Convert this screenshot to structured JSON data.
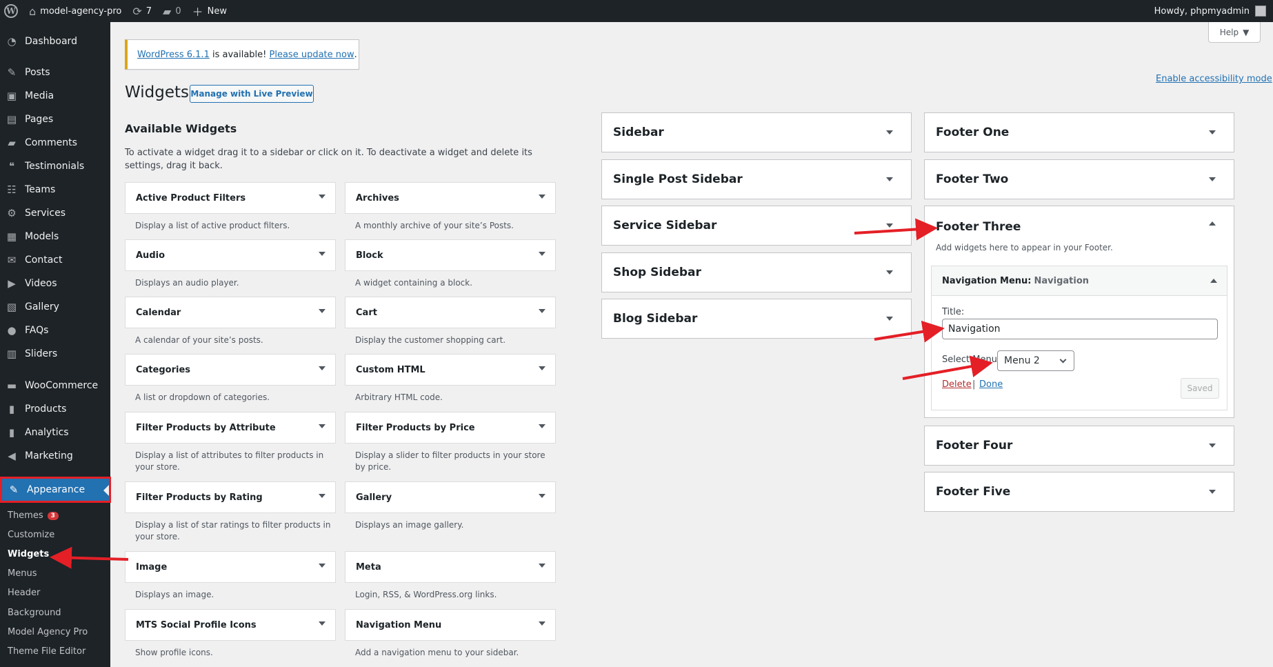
{
  "admin_bar": {
    "site_name": "model-agency-pro",
    "updates_count": "7",
    "comments_count": "0",
    "new_label": "New",
    "greeting": "Howdy, phpmyadmin"
  },
  "sidebar": {
    "items": [
      {
        "label": "Dashboard",
        "icon": "dashboard-icon"
      },
      {
        "label": "Posts",
        "icon": "pin-icon"
      },
      {
        "label": "Media",
        "icon": "media-icon"
      },
      {
        "label": "Pages",
        "icon": "pages-icon"
      },
      {
        "label": "Comments",
        "icon": "comment-icon"
      },
      {
        "label": "Testimonials",
        "icon": "testimonial-icon"
      },
      {
        "label": "Teams",
        "icon": "groups-icon"
      },
      {
        "label": "Services",
        "icon": "services-icon"
      },
      {
        "label": "Models",
        "icon": "models-icon"
      },
      {
        "label": "Contact",
        "icon": "mail-icon"
      },
      {
        "label": "Videos",
        "icon": "video-icon"
      },
      {
        "label": "Gallery",
        "icon": "gallery-icon"
      },
      {
        "label": "FAQs",
        "icon": "faq-icon"
      },
      {
        "label": "Sliders",
        "icon": "sliders-icon"
      },
      {
        "label": "WooCommerce",
        "icon": "woo-icon"
      },
      {
        "label": "Products",
        "icon": "products-icon"
      },
      {
        "label": "Analytics",
        "icon": "analytics-icon"
      },
      {
        "label": "Marketing",
        "icon": "megaphone-icon"
      },
      {
        "label": "Appearance",
        "icon": "paintbrush-icon"
      }
    ],
    "submenu": [
      {
        "label": "Themes",
        "badge": "3"
      },
      {
        "label": "Customize"
      },
      {
        "label": "Widgets"
      },
      {
        "label": "Menus"
      },
      {
        "label": "Header"
      },
      {
        "label": "Background"
      },
      {
        "label": "Model Agency Pro"
      },
      {
        "label": "Theme File Editor"
      }
    ]
  },
  "notice": {
    "version_link": "WordPress 6.1.1",
    "middle": " is available! ",
    "update_link": "Please update now",
    "end": "."
  },
  "header": {
    "help_label": "Help",
    "accessibility_link": "Enable accessibility mode",
    "title": "Widgets",
    "live_preview_label": "Manage with Live Preview"
  },
  "available": {
    "title": "Available Widgets",
    "description": "To activate a widget drag it to a sidebar or click on it. To deactivate a widget and delete its settings, drag it back.",
    "widgets": [
      {
        "name": "Active Product Filters",
        "desc": "Display a list of active product filters."
      },
      {
        "name": "Archives",
        "desc": "A monthly archive of your site’s Posts."
      },
      {
        "name": "Audio",
        "desc": "Displays an audio player."
      },
      {
        "name": "Block",
        "desc": "A widget containing a block."
      },
      {
        "name": "Calendar",
        "desc": "A calendar of your site’s posts."
      },
      {
        "name": "Cart",
        "desc": "Display the customer shopping cart."
      },
      {
        "name": "Categories",
        "desc": "A list or dropdown of categories."
      },
      {
        "name": "Custom HTML",
        "desc": "Arbitrary HTML code."
      },
      {
        "name": "Filter Products by Attribute",
        "desc": "Display a list of attributes to filter products in your store."
      },
      {
        "name": "Filter Products by Price",
        "desc": "Display a slider to filter products in your store by price."
      },
      {
        "name": "Filter Products by Rating",
        "desc": "Display a list of star ratings to filter products in your store."
      },
      {
        "name": "Gallery",
        "desc": "Displays an image gallery."
      },
      {
        "name": "Image",
        "desc": "Displays an image."
      },
      {
        "name": "Meta",
        "desc": "Login, RSS, & WordPress.org links."
      },
      {
        "name": "MTS Social Profile Icons",
        "desc": "Show profile icons."
      },
      {
        "name": "Navigation Menu",
        "desc": "Add a navigation menu to your sidebar."
      }
    ]
  },
  "areas_left": [
    "Sidebar",
    "Single Post Sidebar",
    "Service Sidebar",
    "Shop Sidebar",
    "Blog Sidebar"
  ],
  "areas_right": {
    "footer_one": "Footer One",
    "footer_two": "Footer Two",
    "footer_three": {
      "title": "Footer Three",
      "description": "Add widgets here to appear in your Footer.",
      "widget": {
        "name": "Navigation Menu:",
        "subtitle": "Navigation",
        "title_label": "Title:",
        "title_value": "Navigation",
        "select_label": "Select Menu:",
        "select_value": "Menu 2",
        "delete_label": "Delete",
        "separator": "|",
        "done_label": "Done",
        "saved_label": "Saved"
      }
    },
    "footer_four": "Footer Four",
    "footer_five": "Footer Five"
  },
  "colors": {
    "accent": "#2271b1",
    "annotation_red": "#e41f26",
    "admin_dark": "#1d2327"
  }
}
